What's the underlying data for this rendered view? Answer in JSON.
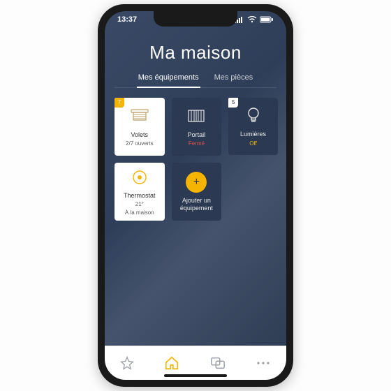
{
  "statusbar": {
    "time": "13:37"
  },
  "header": {
    "title": "Ma maison"
  },
  "tabs": [
    {
      "label": "Mes équipements",
      "active": true
    },
    {
      "label": "Mes pièces",
      "active": false
    }
  ],
  "cards": {
    "volets": {
      "badge": "7",
      "title": "Volets",
      "sub": "2/7 ouverts"
    },
    "portail": {
      "title": "Portail",
      "sub": "Fermé"
    },
    "lumieres": {
      "badge": "5",
      "title": "Lumières",
      "sub": "Off"
    },
    "thermostat": {
      "title": "Thermostat",
      "sub1": "21°",
      "sub2": "À la maison"
    },
    "add": {
      "title": "Ajouter un équipement"
    }
  }
}
